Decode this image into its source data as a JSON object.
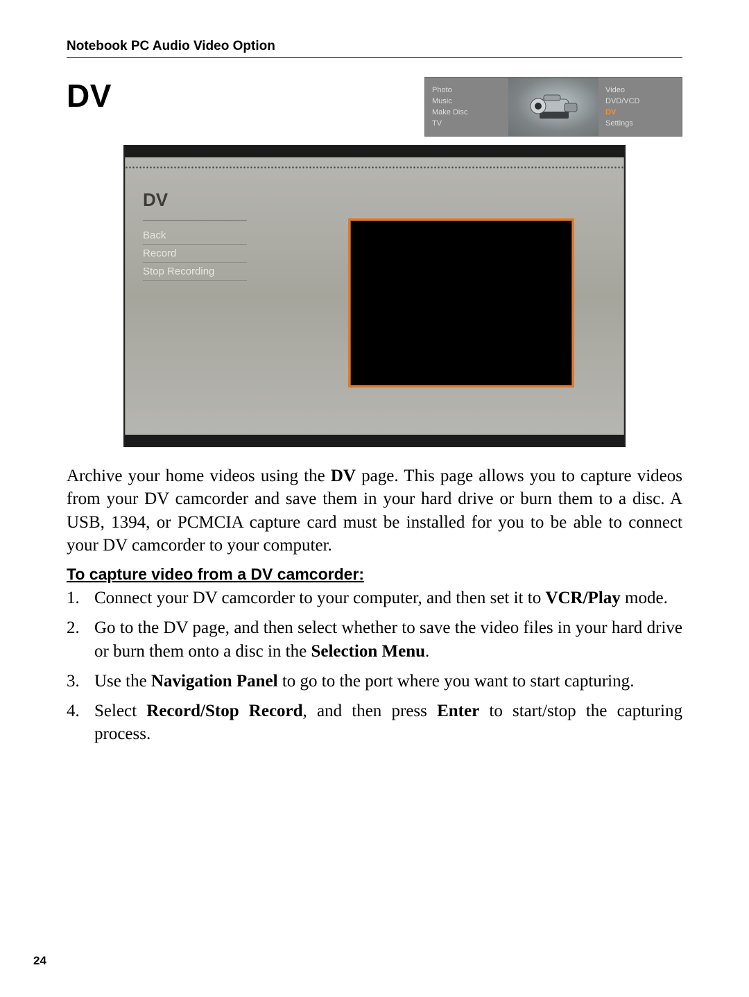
{
  "header": {
    "running": "Notebook PC Audio Video Option"
  },
  "title": "DV",
  "banner": {
    "left": [
      "Photo",
      "Music",
      "Make Disc",
      "TV"
    ],
    "right": [
      {
        "label": "Video",
        "active": false
      },
      {
        "label": "DVD/VCD",
        "active": false
      },
      {
        "label": "DV",
        "active": true
      },
      {
        "label": "Settings",
        "active": false
      }
    ]
  },
  "screenshot": {
    "sidebar_title": "DV",
    "options": [
      "Back",
      "Record",
      "Stop Recording"
    ]
  },
  "intro": {
    "pre": "Archive your home videos using the ",
    "bold": "DV",
    "post": " page. This page allows you to capture videos from your DV camcorder and save them in your hard drive or burn them to a disc. A USB, 1394, or PCMCIA capture card must be installed for you to be able to connect your DV camcorder to your computer."
  },
  "subhead": "To capture video from a DV camcorder:",
  "steps": [
    {
      "pre": "Connect your DV camcorder to your computer, and then set it to ",
      "b1": "VCR/Play",
      "post": " mode."
    },
    {
      "pre": "Go to the DV page, and then select whether to save the video files in your hard drive or burn them onto a disc in the ",
      "b1": "Selection Menu",
      "post": "."
    },
    {
      "pre": "Use the ",
      "b1": "Navigation Panel",
      "post": " to go to the port where you want to start capturing."
    },
    {
      "pre": "Select ",
      "b1": "Record/Stop Record",
      "mid": ", and then press ",
      "b2": "Enter",
      "post": " to start/stop the capturing process."
    }
  ],
  "page_number": "24"
}
